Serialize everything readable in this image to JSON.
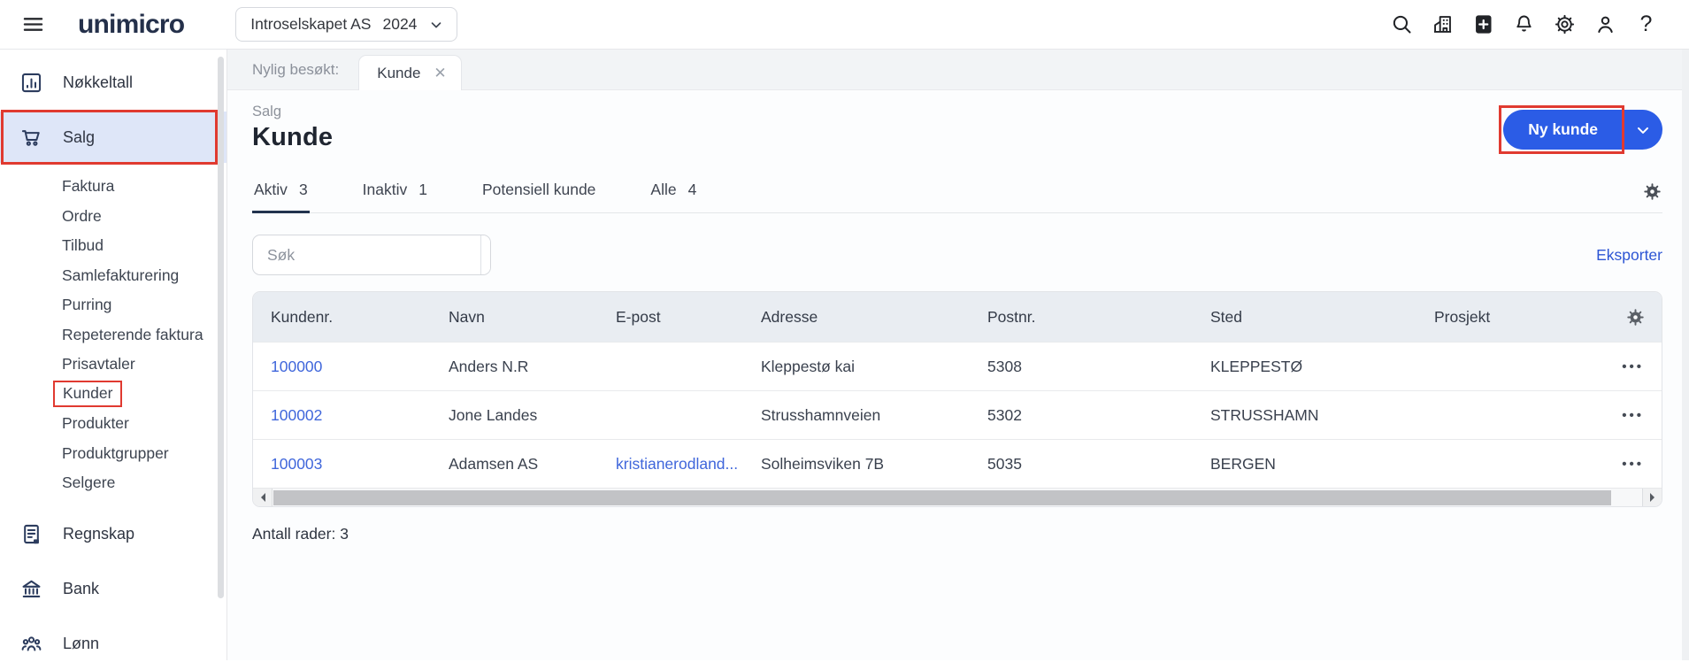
{
  "colors": {
    "accent_blue": "#2b5ce6",
    "link_blue": "#3f66db",
    "annotation_red": "#e03a30",
    "active_item_bg": "#dee6f8",
    "table_header_bg": "#e9edf2",
    "sidebar_icon_navy": "#2c3c5e"
  },
  "header": {
    "logo": "unimicro",
    "company": {
      "name": "Introselskapet AS",
      "year": "2024"
    },
    "icons": [
      "search",
      "company",
      "add",
      "notifications",
      "settings",
      "user",
      "help"
    ]
  },
  "sidebar": {
    "items": [
      {
        "label": "Nøkkeltall",
        "icon": "bar-chart"
      },
      {
        "label": "Salg",
        "icon": "cart",
        "active": true,
        "annotated": true,
        "children": [
          {
            "label": "Faktura"
          },
          {
            "label": "Ordre"
          },
          {
            "label": "Tilbud"
          },
          {
            "label": "Samlefakturering"
          },
          {
            "label": "Purring"
          },
          {
            "label": "Repeterende faktura"
          },
          {
            "label": "Prisavtaler"
          },
          {
            "label": "Kunder",
            "annotated": true
          },
          {
            "label": "Produkter"
          },
          {
            "label": "Produktgrupper"
          },
          {
            "label": "Selgere"
          }
        ]
      },
      {
        "label": "Regnskap",
        "icon": "ledger"
      },
      {
        "label": "Bank",
        "icon": "bank"
      },
      {
        "label": "Lønn",
        "icon": "people"
      }
    ]
  },
  "recent": {
    "label": "Nylig besøkt:",
    "tab_label": "Kunde",
    "close_glyph": "✕"
  },
  "page": {
    "breadcrumb": "Salg",
    "title": "Kunde",
    "new_button_label": "Ny kunde"
  },
  "view_tabs": [
    {
      "label": "Aktiv",
      "count": "3",
      "active": true
    },
    {
      "label": "Inaktiv",
      "count": "1"
    },
    {
      "label": "Potensiell kunde",
      "count": ""
    },
    {
      "label": "Alle",
      "count": "4"
    }
  ],
  "toolbar": {
    "search_placeholder": "Søk",
    "export_label": "Eksporter"
  },
  "table": {
    "columns": [
      "Kundenr.",
      "Navn",
      "E-post",
      "Adresse",
      "Postnr.",
      "Sted",
      "Prosjekt"
    ],
    "rows": [
      {
        "kundenr": "100000",
        "navn": "Anders N.R",
        "epost": "",
        "adresse": "Kleppestø kai",
        "postnr": "5308",
        "sted": "KLEPPESTØ",
        "prosjekt": ""
      },
      {
        "kundenr": "100002",
        "navn": "Jone Landes",
        "epost": "",
        "adresse": "Strusshamnveien",
        "postnr": "5302",
        "sted": "STRUSSHAMN",
        "prosjekt": ""
      },
      {
        "kundenr": "100003",
        "navn": "Adamsen AS",
        "epost": "kristianerodland...",
        "adresse": "Solheimsviken 7B",
        "postnr": "5035",
        "sted": "BERGEN",
        "prosjekt": ""
      }
    ]
  },
  "footer": {
    "row_count_label": "Antall rader: 3"
  }
}
